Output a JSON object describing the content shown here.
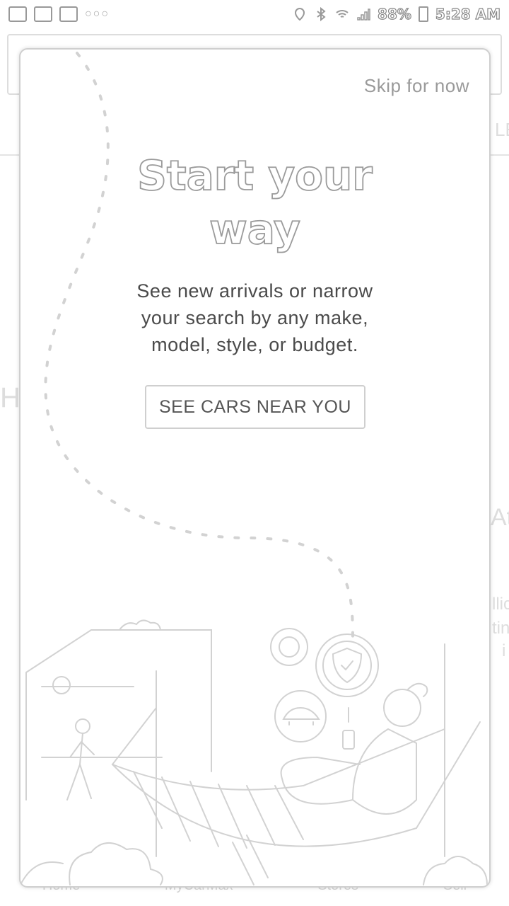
{
  "status_bar": {
    "battery": "88%",
    "time": "5:28 AM",
    "left_icons": [
      "checkbox-icon",
      "image-icon",
      "mail-icon",
      "more-dots-icon"
    ],
    "right_icons": [
      "location-icon",
      "bluetooth-icon",
      "wifi-icon",
      "signal-icon",
      "battery-icon"
    ]
  },
  "background": {
    "nav_items": [
      "Home",
      "MyCarMax",
      "Stores",
      "Sell"
    ],
    "fragments": [
      "LE",
      "H",
      "At",
      "llic",
      "tin",
      "i"
    ]
  },
  "onboarding": {
    "skip_label": "Skip for now",
    "title_lines": [
      "Start your",
      "way"
    ],
    "body_lines": [
      "See new arrivals or narrow",
      "your search by any make,",
      "model, style, or budget."
    ],
    "cta_label": "SEE CARS NEAR YOU",
    "colors": {
      "line_art": "#cfcfcf",
      "text": "#4a4a4a",
      "muted": "#9a9a9a"
    }
  }
}
